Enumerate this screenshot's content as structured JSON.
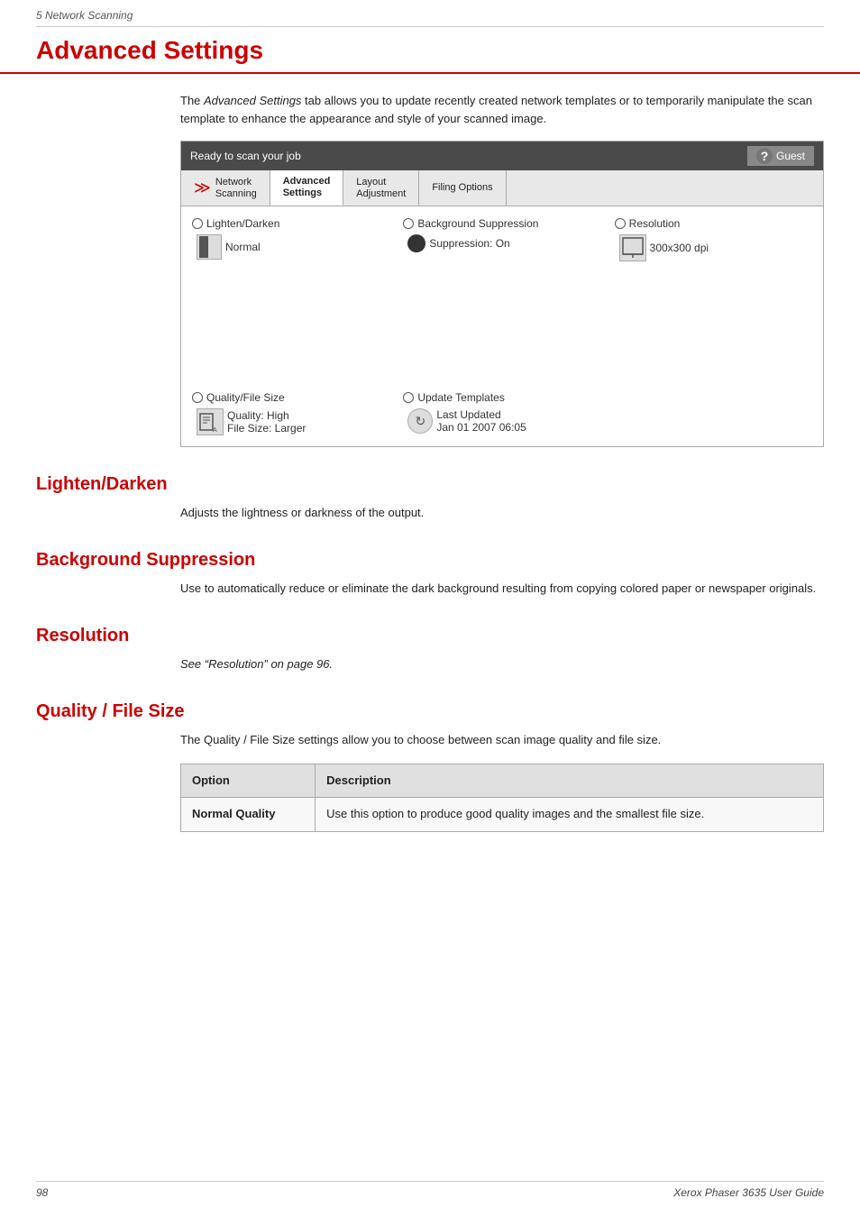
{
  "breadcrumb": "5   Network Scanning",
  "page_title": "Advanced Settings",
  "intro": {
    "text_parts": [
      "The ",
      "Advanced Settings",
      " tab allows you to update recently created network templates or to temporarily manipulate the scan template to enhance the appearance and style of your scanned image."
    ]
  },
  "scanner_panel": {
    "header": "Ready to scan your job",
    "guest_label": "Guest",
    "tabs": [
      {
        "label": "Network\nScanning",
        "active": false
      },
      {
        "label": "Advanced\nSettings",
        "active": true
      },
      {
        "label": "Layout\nAdjustment",
        "active": false
      },
      {
        "label": "Filing Options",
        "active": false
      }
    ],
    "options_row1": [
      {
        "label": "Lighten/Darken",
        "value": "Normal"
      },
      {
        "label": "Background Suppression",
        "value": "Suppression: On"
      },
      {
        "label": "Resolution",
        "value": "300x300 dpi"
      }
    ],
    "options_row2": [
      {
        "label": "Quality/File Size",
        "value1": "Quality: High",
        "value2": "File Size: Larger"
      },
      {
        "label": "Update Templates",
        "value1": "Last Updated",
        "value2": "Jan 01 2007 06:05"
      }
    ]
  },
  "sections": [
    {
      "heading": "Lighten/Darken",
      "body": "Adjusts the lightness or darkness of the output."
    },
    {
      "heading": "Background Suppression",
      "body": "Use to automatically reduce or eliminate the dark background resulting from copying colored paper or newspaper originals."
    },
    {
      "heading": "Resolution",
      "body": "See “Resolution” on page 96."
    },
    {
      "heading": "Quality / File Size",
      "body": "The Quality / File Size settings allow you to choose between scan image quality and file size."
    }
  ],
  "table": {
    "headers": [
      "Option",
      "Description"
    ],
    "rows": [
      {
        "option": "Normal Quality",
        "description": "Use this option to produce good quality images and the smallest file size."
      }
    ]
  },
  "footer": {
    "page_number": "98",
    "product": "Xerox Phaser 3635 User Guide"
  }
}
